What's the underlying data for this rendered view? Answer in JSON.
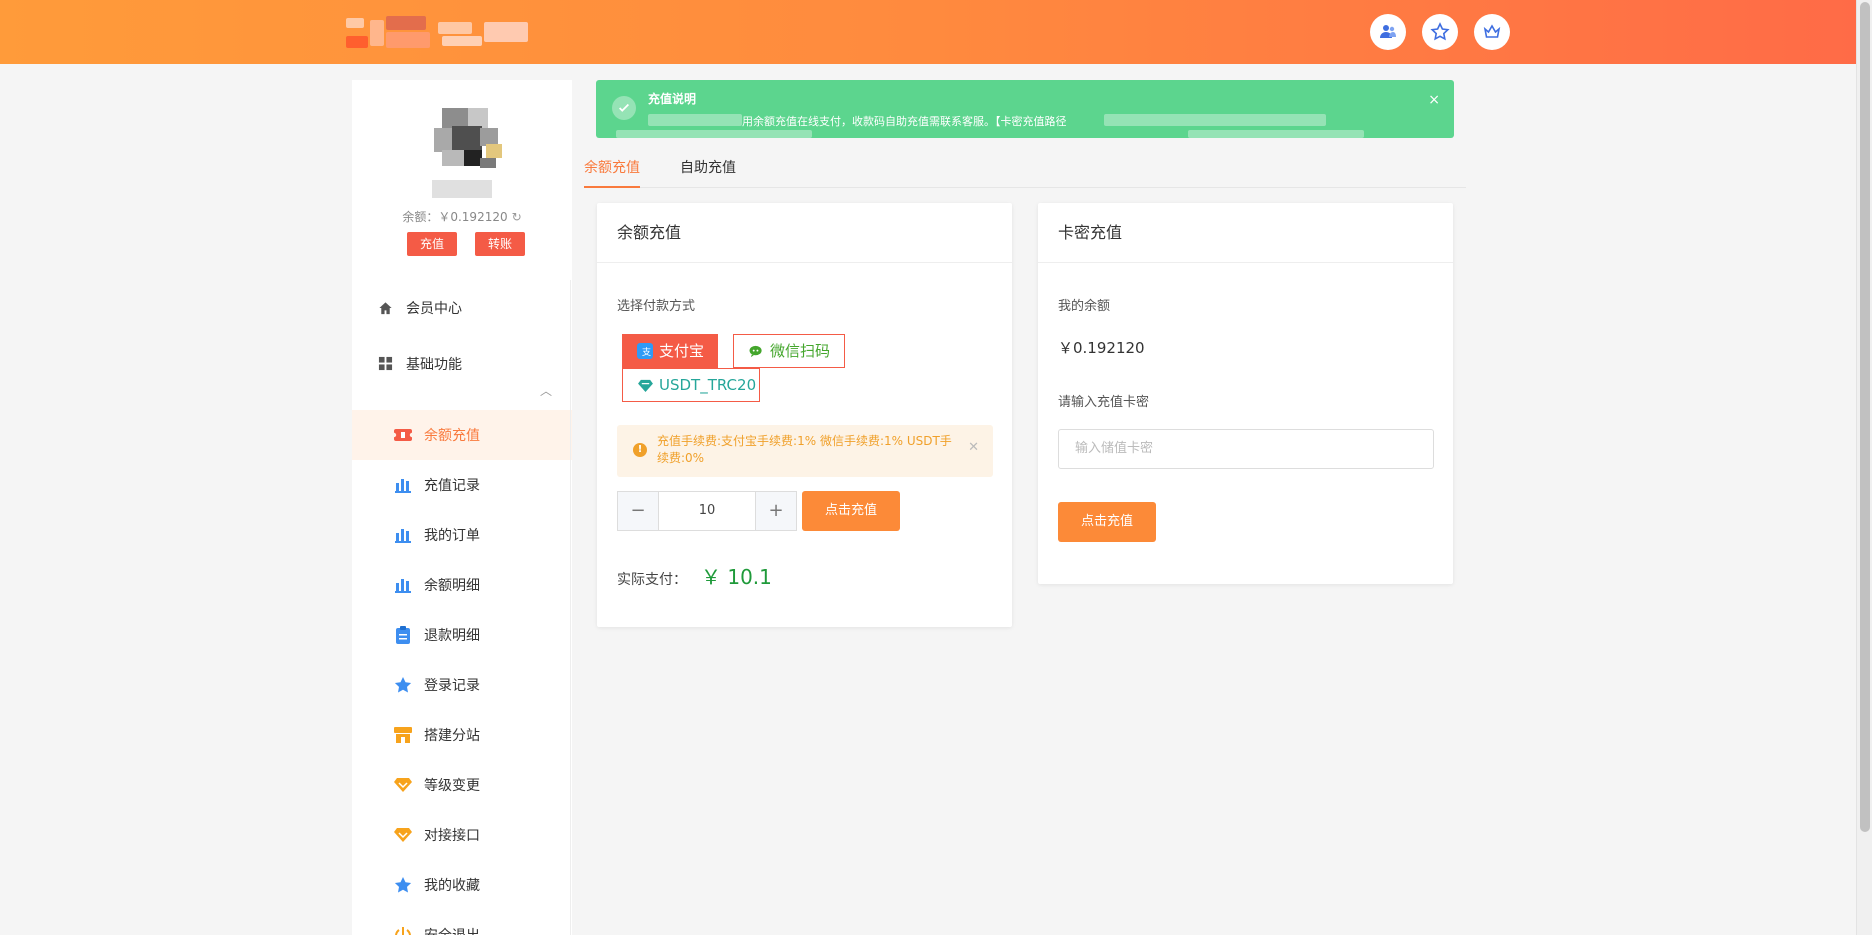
{
  "header": {
    "icons": [
      "user-group-icon",
      "star-icon",
      "crown-icon"
    ]
  },
  "sidebar": {
    "balance_label": "余额：",
    "balance_value": "￥0.192120",
    "recharge_btn": "充值",
    "transfer_btn": "转账",
    "menu": [
      {
        "label": "会员中心",
        "icon": "home-icon"
      },
      {
        "label": "基础功能",
        "icon": "grid-icon"
      }
    ],
    "submenu": [
      {
        "label": "余额充值",
        "icon": "ticket-icon",
        "active": true
      },
      {
        "label": "充值记录",
        "icon": "bar-chart-icon"
      },
      {
        "label": "我的订单",
        "icon": "bar-chart-icon"
      },
      {
        "label": "余额明细",
        "icon": "bar-chart-icon"
      },
      {
        "label": "退款明细",
        "icon": "clipboard-icon"
      },
      {
        "label": "登录记录",
        "icon": "star-icon"
      },
      {
        "label": "搭建分站",
        "icon": "shop-icon"
      },
      {
        "label": "等级变更",
        "icon": "diamond-icon"
      },
      {
        "label": "对接接口",
        "icon": "diamond-icon"
      },
      {
        "label": "我的收藏",
        "icon": "star-icon"
      },
      {
        "label": "安全退出",
        "icon": "power-icon"
      }
    ]
  },
  "alert": {
    "title": "充值说明",
    "text": "用余额充值在线支付，收款码自助充值需联系客服。【卡密充值路径",
    "close": "×"
  },
  "tabs": [
    {
      "label": "余额充值",
      "active": true
    },
    {
      "label": "自助充值",
      "active": false
    }
  ],
  "balance_card": {
    "title": "余额充值",
    "pay_method_label": "选择付款方式",
    "methods": [
      {
        "label": "支付宝",
        "selected": true
      },
      {
        "label": "微信扫码",
        "selected": false
      },
      {
        "label": "USDT_TRC20",
        "selected": false
      }
    ],
    "fee_text": "充值手续费:支付宝手续费:1% 微信手续费:1% USDT手续费:0%",
    "quantity": "10",
    "minus": "−",
    "plus": "+",
    "submit": "点击充值",
    "actual_pay_label": "实际支付：",
    "actual_pay_value": "￥ 10.1"
  },
  "card_card": {
    "title": "卡密充值",
    "my_balance_label": "我的余额",
    "my_balance_value": "￥0.192120",
    "input_label": "请输入充值卡密",
    "input_placeholder": "输入储值卡密",
    "submit": "点击充值"
  },
  "colors": {
    "accent": "#f97a3d",
    "button_red": "#f45b46",
    "alert_green": "#5cd58e",
    "pay_green": "#1f9a3a"
  }
}
